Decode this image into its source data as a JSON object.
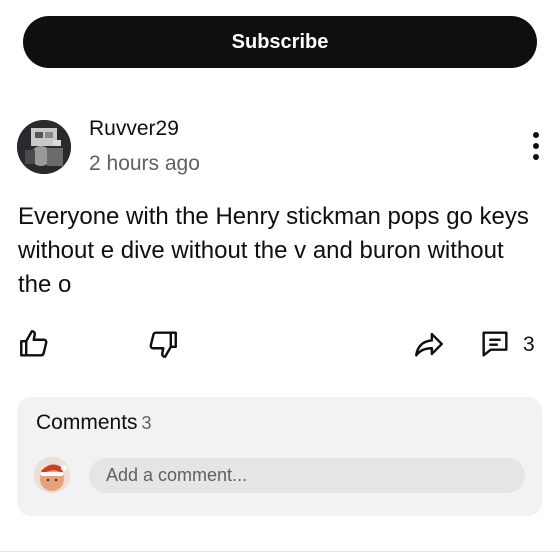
{
  "header": {
    "subscribe_label": "Subscribe"
  },
  "comment": {
    "author": "Ruvver29",
    "time": "2 hours ago",
    "text": "Everyone with the Henry stickman pops go keys without e dive without the v and buron without the o",
    "reply_count": "3"
  },
  "icons": {
    "menu": "more-vert-icon",
    "like": "thumb-up-icon",
    "dislike": "thumb-down-icon",
    "share": "share-icon",
    "reply": "comment-icon"
  },
  "comments_panel": {
    "title": "Comments",
    "count": "3",
    "placeholder": "Add a comment..."
  },
  "colors": {
    "primary_text": "#0f0f0f",
    "secondary_text": "#606060",
    "button_bg": "#0f0f0f",
    "panel_bg": "#f2f2f2",
    "input_bg": "#e5e5e5"
  }
}
